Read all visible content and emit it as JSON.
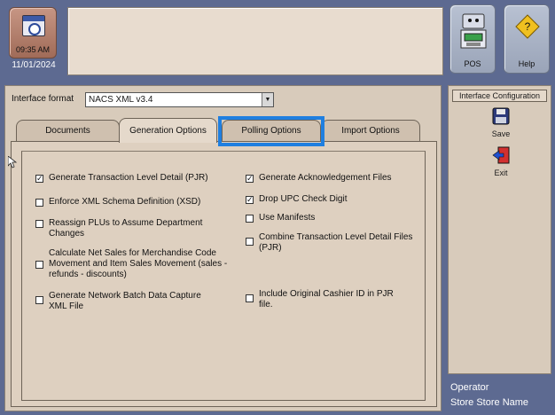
{
  "clock": {
    "time": "09:35 AM",
    "date": "11/01/2024"
  },
  "toolbar": {
    "pos_label": "POS",
    "help_label": "Help"
  },
  "interface_format": {
    "label": "Interface format",
    "selected": "NACS XML v3.4"
  },
  "tabs": [
    {
      "label": "Documents",
      "active": false
    },
    {
      "label": "Generation Options",
      "active": true
    },
    {
      "label": "Polling Options",
      "active": false,
      "highlighted": true
    },
    {
      "label": "Import Options",
      "active": false
    }
  ],
  "options": {
    "left": [
      {
        "label": "Generate Transaction Level Detail (PJR)",
        "checked": true
      },
      {
        "label": "Enforce XML Schema Definition (XSD)",
        "checked": false
      },
      {
        "label": "Reassign PLUs to Assume Department Changes",
        "checked": false
      },
      {
        "label": "Calculate Net Sales for Merchandise Code Movement and Item Sales Movement  (sales - refunds - discounts)",
        "checked": false
      },
      {
        "label": "Generate Network Batch Data Capture XML File",
        "checked": false
      }
    ],
    "right": [
      {
        "label": "Generate Acknowledgement Files",
        "checked": true
      },
      {
        "label": "Drop UPC Check Digit",
        "checked": true
      },
      {
        "label": "Use Manifests",
        "checked": false
      },
      {
        "label": "Combine Transaction Level Detail Files (PJR)",
        "checked": false
      },
      {
        "label": "Include Original Cashier ID in PJR file.",
        "checked": false
      }
    ]
  },
  "side_panel": {
    "title": "Interface Configuration",
    "save_label": "Save",
    "exit_label": "Exit"
  },
  "footer": {
    "operator": "Operator",
    "store": "Store Store Name"
  },
  "colors": {
    "highlight": "#1f7fe0",
    "background": "#5d6a91",
    "panel": "#d8cbbb"
  }
}
